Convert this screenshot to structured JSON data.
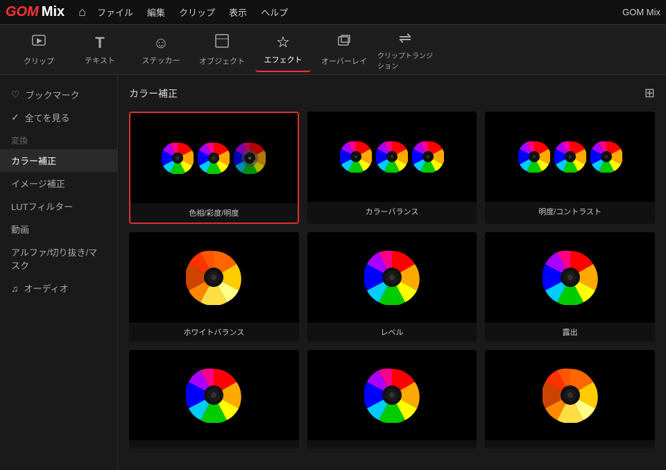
{
  "app": {
    "logo_gom": "GOM",
    "logo_mix": "Mix",
    "title_right": "GOM Mix"
  },
  "menu": {
    "home_icon": "⌂",
    "items": [
      {
        "label": "ファイル"
      },
      {
        "label": "編集"
      },
      {
        "label": "クリップ"
      },
      {
        "label": "表示"
      },
      {
        "label": "ヘルプ"
      }
    ]
  },
  "toolbar": {
    "items": [
      {
        "id": "clip",
        "icon": "▷",
        "label": "クリップ",
        "active": false
      },
      {
        "id": "text",
        "icon": "T",
        "label": "テキスト",
        "active": false
      },
      {
        "id": "sticker",
        "icon": "☺",
        "label": "ステッカー",
        "active": false
      },
      {
        "id": "object",
        "icon": "▣",
        "label": "オブジェクト",
        "active": false
      },
      {
        "id": "effect",
        "icon": "☆",
        "label": "エフェクト",
        "active": true
      },
      {
        "id": "overlay",
        "icon": "⧉",
        "label": "オーバーレイ",
        "active": false
      },
      {
        "id": "transition",
        "icon": "⇌",
        "label": "クリップトランジション",
        "active": false
      }
    ]
  },
  "sidebar": {
    "items": [
      {
        "id": "bookmark",
        "icon": "♡",
        "label": "ブックマーク"
      },
      {
        "id": "all",
        "icon": "✓",
        "label": "全てを見る"
      },
      {
        "id": "section_henkan",
        "label": "変換",
        "is_section": false
      },
      {
        "id": "color_correction",
        "label": "カラー補正",
        "active": true
      },
      {
        "id": "image_correction",
        "label": "イメージ補正"
      },
      {
        "id": "lut_filter",
        "label": "LUTフィルター"
      },
      {
        "id": "video",
        "label": "動画"
      },
      {
        "id": "alpha_mask",
        "label": "アルファ/切り抜き/マスク"
      },
      {
        "id": "audio",
        "icon": "♫",
        "label": "オーディオ"
      }
    ]
  },
  "content": {
    "title": "カラー補正",
    "grid_icon": "⊞",
    "effects": [
      {
        "id": "hue_saturation",
        "label": "色相/彩度/明度",
        "selected": true,
        "wheels": 3
      },
      {
        "id": "color_balance",
        "label": "カラーバランス",
        "selected": false,
        "wheels": 3
      },
      {
        "id": "brightness_contrast",
        "label": "明度/コントラスト",
        "selected": false,
        "wheels": 3
      },
      {
        "id": "white_balance",
        "label": "ホワイトバランス",
        "selected": false,
        "wheels": 1
      },
      {
        "id": "level",
        "label": "レベル",
        "selected": false,
        "wheels": 1
      },
      {
        "id": "exposure",
        "label": "露出",
        "selected": false,
        "wheels": 1
      },
      {
        "id": "effect7",
        "label": "",
        "selected": false,
        "wheels": 1
      },
      {
        "id": "effect8",
        "label": "",
        "selected": false,
        "wheels": 1
      },
      {
        "id": "effect9",
        "label": "",
        "selected": false,
        "wheels": 1
      }
    ]
  }
}
